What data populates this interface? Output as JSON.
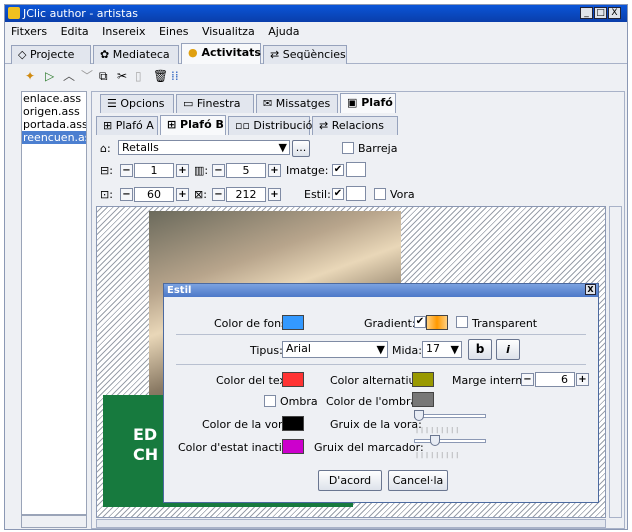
{
  "window": {
    "title": "JClic author - artistas",
    "controls": [
      "_",
      "□",
      "X"
    ]
  },
  "menu": [
    "Fitxers",
    "Edita",
    "Insereix",
    "Eines",
    "Visualitza",
    "Ajuda"
  ],
  "app_tabs": [
    {
      "label": "Projecte",
      "icon": "project-icon"
    },
    {
      "label": "Mediateca",
      "icon": "media-icon"
    },
    {
      "label": "Activitats",
      "icon": "activities-icon"
    },
    {
      "label": "Seqüències",
      "icon": "sequences-icon"
    }
  ],
  "toolbar_icons": [
    "new-activity-icon",
    "play-icon",
    "up-icon",
    "down-icon",
    "copy-icon",
    "cut-icon",
    "paste-icon",
    "delete-icon",
    "grid-icon"
  ],
  "files": [
    "enlace.ass",
    "origen.ass",
    "portada.ass",
    "reencuen.as"
  ],
  "activity_tabs": [
    "Opcions",
    "Finestra",
    "Missatges",
    "Plafó"
  ],
  "panel_tabs": [
    "Plafó A",
    "Plafó B",
    "Distribució",
    "Relacions"
  ],
  "panel": {
    "shape": "Retalls",
    "ellipsis": "...",
    "barreja": "Barreja",
    "rows": "1",
    "cols": "5",
    "width": "60",
    "height": "212",
    "imatge": "Imatge:",
    "estil": "Estil:",
    "vora": "Vora",
    "minus": "−",
    "plus": "+"
  },
  "canvas": {
    "text_line1": "ED",
    "text_line2": "CH"
  },
  "dialog": {
    "title": "Estil",
    "close": "X",
    "color_fons": "Color de fons:",
    "gradient": "Gradient:",
    "transparent": "Transparent",
    "tipus": "Tipus:",
    "font": "Arial",
    "mida": "Mida:",
    "size": "17",
    "bold": "b",
    "italic": "i",
    "color_text": "Color del text:",
    "color_alternatiu": "Color alternatiu:",
    "marge_intern": "Marge intern:",
    "marge_value": "6",
    "ombra": "Ombra",
    "color_ombra": "Color de l'ombra:",
    "color_vora": "Color de la vora:",
    "gruix_vora": "Gruix de la vora:",
    "color_inactiu": "Color d'estat inactiu:",
    "gruix_marcador": "Gruix del marcador:",
    "ok": "D'acord",
    "cancel": "Cancel·la",
    "colors": {
      "fons": "#3399ff",
      "text": "#ff3333",
      "alternatiu": "#999900",
      "ombra": "#777777",
      "vora": "#000000",
      "inactiu": "#cc00cc",
      "gradient": "#ff9900"
    },
    "gruix_vora_value": 0.0,
    "gruix_marcador_value": 0.25
  },
  "colors": {
    "titlebar": "#0a48c4",
    "selected_file": "#4c7fd0",
    "green_block": "#177a3e"
  }
}
